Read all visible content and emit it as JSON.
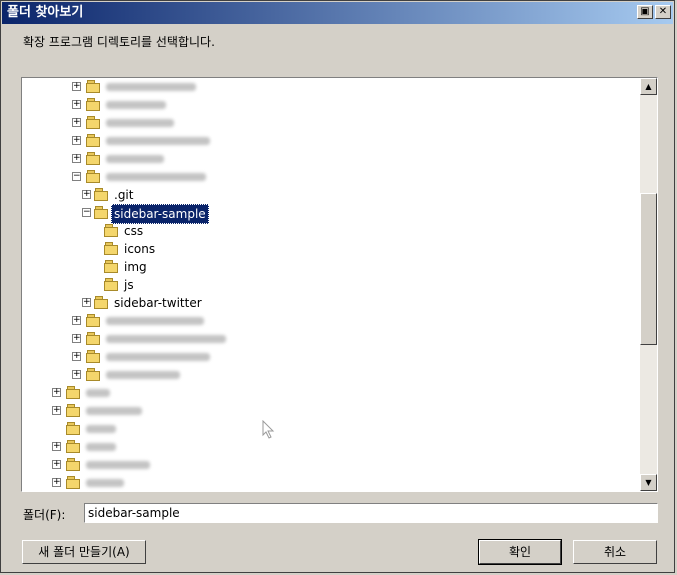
{
  "window": {
    "title": "폴더 찾아보기",
    "restore_glyph": "▣",
    "close_glyph": "✕"
  },
  "instruction": "확장 프로그램 디렉토리를 선택합니다.",
  "tree": {
    "visible_items": [
      ".git",
      "sidebar-sample",
      "css",
      "icons",
      "img",
      "js",
      "sidebar-twitter"
    ],
    "selected": "sidebar-sample"
  },
  "folder_field": {
    "label": "폴더(F):",
    "value": "sidebar-sample"
  },
  "buttons": {
    "new_folder": "새 폴더 만들기(A)",
    "ok": "확인",
    "cancel": "취소"
  },
  "scrollbar": {
    "up_glyph": "▲",
    "down_glyph": "▼"
  }
}
